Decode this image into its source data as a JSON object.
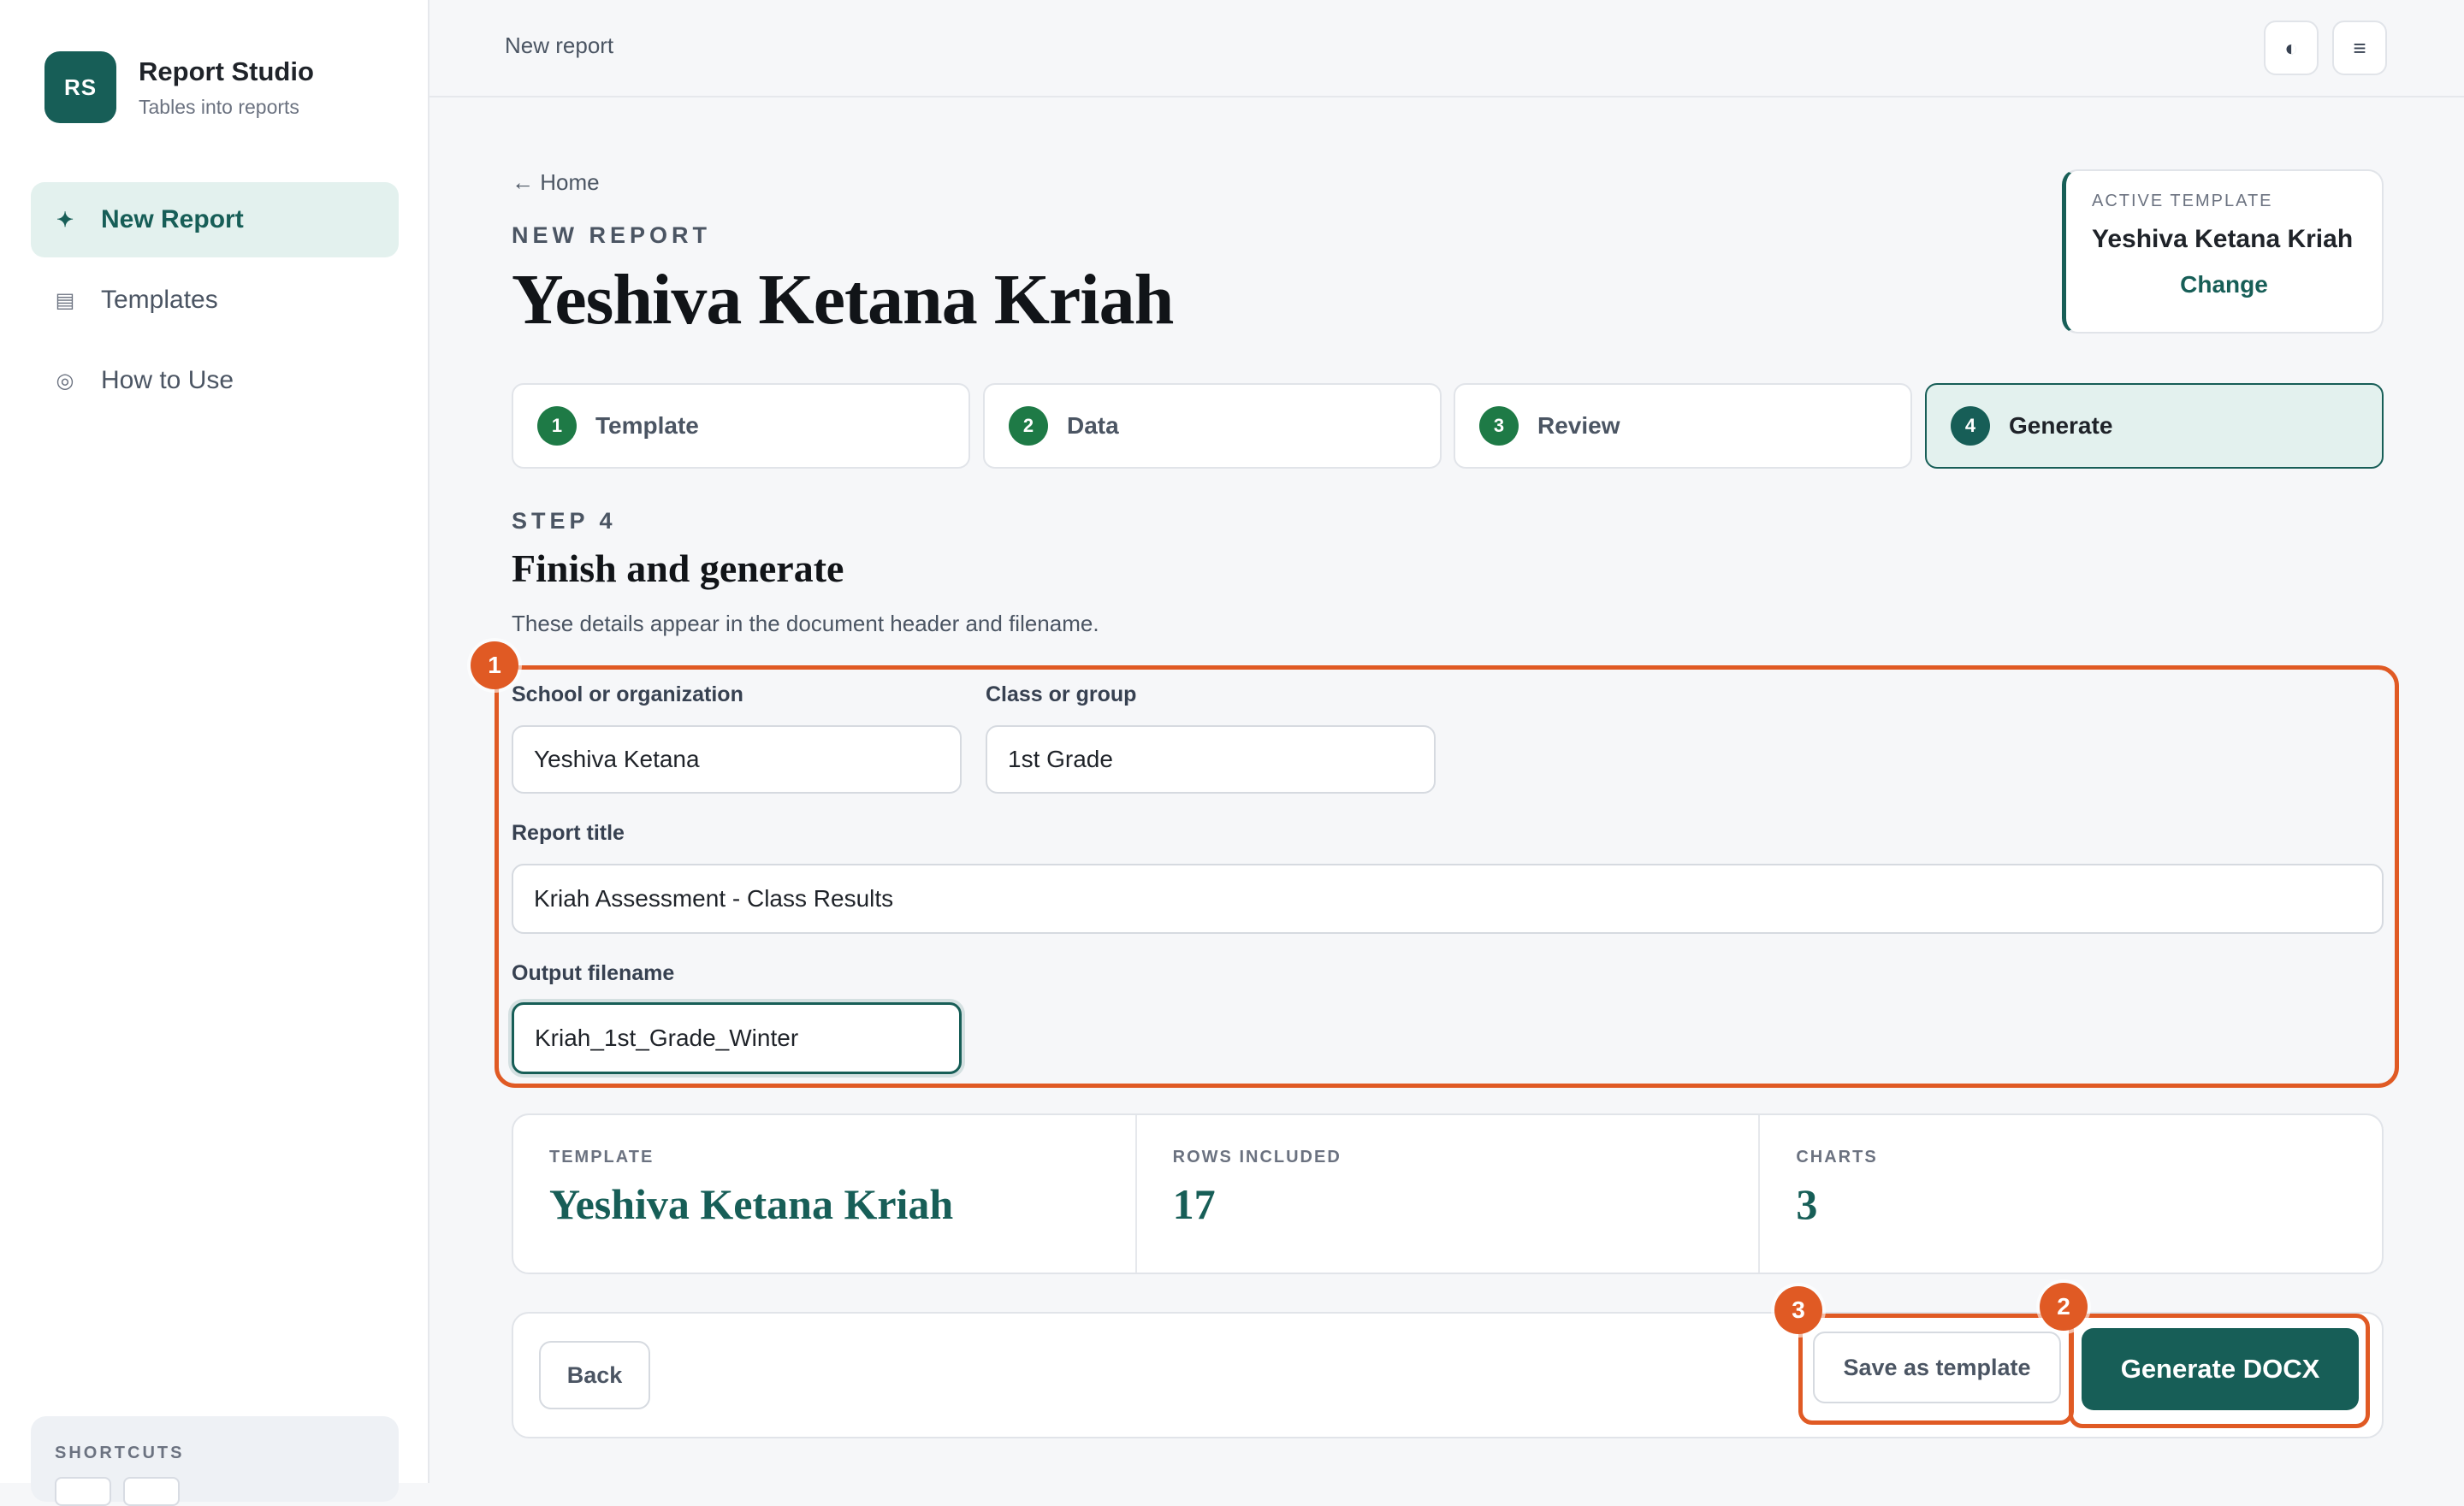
{
  "app": {
    "logo_initials": "RS",
    "name": "Report Studio",
    "tagline": "Tables into reports"
  },
  "sidebar": {
    "items": [
      {
        "label": "New Report",
        "icon": "sparkle-icon",
        "active": true
      },
      {
        "label": "Templates",
        "icon": "list-icon",
        "active": false
      },
      {
        "label": "How to Use",
        "icon": "circle-icon",
        "active": false
      }
    ],
    "shortcuts_title": "SHORTCUTS"
  },
  "topbar": {
    "title": "New report",
    "theme_icon": "◐",
    "menu_icon": "≡"
  },
  "header": {
    "back_link": "← Home",
    "eyebrow": "NEW REPORT",
    "title": "Yeshiva Ketana Kriah"
  },
  "active_template": {
    "label": "ACTIVE TEMPLATE",
    "name": "Yeshiva Ketana Kriah",
    "change": "Change"
  },
  "steps": [
    {
      "num": "1",
      "label": "Template"
    },
    {
      "num": "2",
      "label": "Data"
    },
    {
      "num": "3",
      "label": "Review"
    },
    {
      "num": "4",
      "label": "Generate"
    }
  ],
  "section": {
    "eyebrow": "STEP 4",
    "title": "Finish and generate",
    "description": "These details appear in the document header and filename."
  },
  "form": {
    "school": {
      "label": "School or organization",
      "value": "Yeshiva Ketana"
    },
    "class": {
      "label": "Class or group",
      "value": "1st Grade"
    },
    "report_title": {
      "label": "Report title",
      "value": "Kriah Assessment - Class Results"
    },
    "filename": {
      "label": "Output filename",
      "value": "Kriah_1st_Grade_Winter"
    }
  },
  "stats": [
    {
      "label": "TEMPLATE",
      "value": "Yeshiva Ketana Kriah"
    },
    {
      "label": "ROWS INCLUDED",
      "value": "17"
    },
    {
      "label": "CHARTS",
      "value": "3"
    }
  ],
  "actions": {
    "back": "Back",
    "save_template": "Save as template",
    "generate": "Generate DOCX"
  },
  "annotations": [
    "1",
    "2",
    "3"
  ],
  "colors": {
    "accent": "#175e57",
    "highlight": "#e05a24",
    "step_done": "#1e7a46"
  }
}
